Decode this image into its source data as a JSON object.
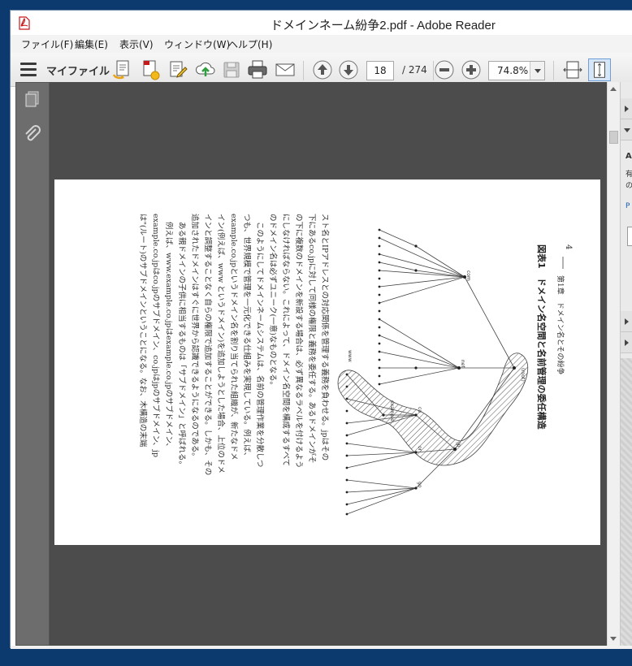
{
  "window": {
    "title": "ドメインネーム紛争2.pdf - Adobe Reader"
  },
  "menu": {
    "items": [
      "ファイル(F)",
      "編集(E)",
      "表示(V)",
      "ウィンドウ(W)",
      "ヘルプ(H)"
    ]
  },
  "toolbar": {
    "my_files_label": "マイファイル",
    "current_page": "18",
    "page_total": "/ 274",
    "zoom": "74.8%"
  },
  "document": {
    "running_head": "第1章　ドメイン名とその紛争",
    "page_number": "4",
    "figure_caption": "図表1　ドメイン名空間と名前管理の委任構造",
    "tree_labels": [
      "(root)",
      "com",
      "net",
      "www",
      "example",
      "co",
      "or",
      "go",
      "jp"
    ],
    "body_lines": [
      "スト名とIPアドレスとの対応関係を管理する義務を負わせる。jpはその",
      "下にあるco.jpに対して同様の権限と義務を委任する。あるドメインがそ",
      "の下に複数のドメインを新設する場合は、必ず異なるラベルを付けるよう",
      "にしなければならない。これによって、ドメイン名空間を構成するすべて",
      "のドメイン名は必ずユニーク(一意)なものとなる。",
      "このようにしてドメインネームシステムは、名前の管理作業を分散しつ",
      "つも、世界規模で管理を一元化できる仕組みを実現している。例えば、",
      "example.co.jpというドメイン名を割り当てられた組織が、新たなドメ",
      "イン(例えば、www というドメイン)を追加しようとした場合、上位のドメ",
      "インと調整することなく自らの権限で追加することができる。しかも、その",
      "追加されたドメインはすぐに世界から認識できるようになるのである。",
      "ある親ドメインの子供に相当するものは「サブドメイン」と呼ばれる。",
      "例えば、www.example.co.jpはexample.co.jpのサブドメイン、",
      "example.co.jpはco.jpのサブドメイン、co.jpはjpのサブドメイン、jp",
      "は\"(ルート)のサブドメインということになる。なお、木構造の末端"
    ]
  },
  "right_pane": {
    "heading": "A",
    "line1": "有",
    "line2": "の",
    "link": "P"
  },
  "colors": {
    "desktop": "#0c3a6e",
    "doc_background": "#4c4c4c",
    "nav_pane": "#6d6d6d",
    "toolbar": "#ececec"
  }
}
